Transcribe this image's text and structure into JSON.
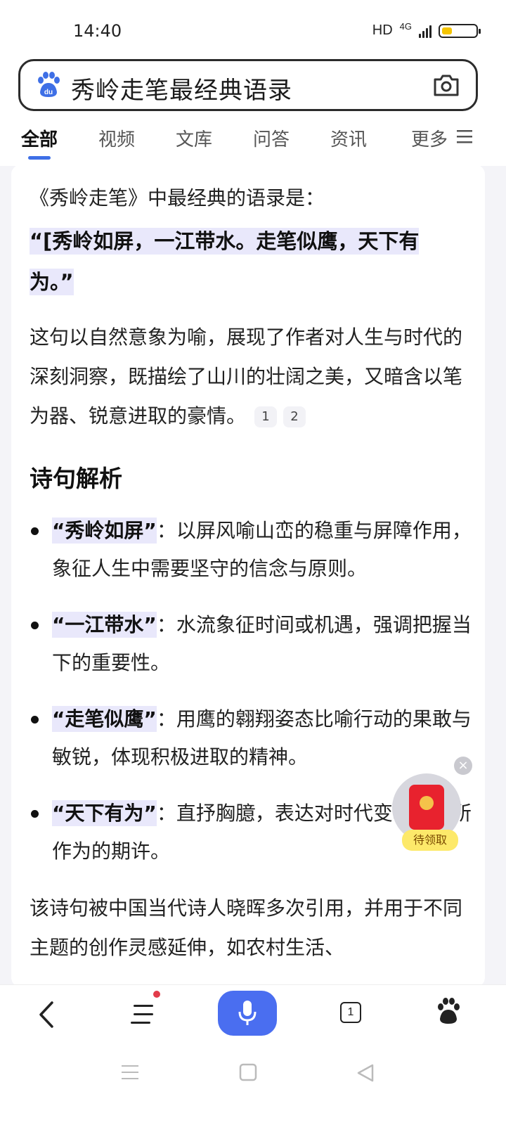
{
  "status_bar": {
    "time": "14:40",
    "hd": "HD",
    "network": "4G",
    "battery_level": 0.3
  },
  "search": {
    "query": "秀岭走笔最经典语录",
    "logo_text": "du"
  },
  "tabs": [
    {
      "label": "全部",
      "active": true
    },
    {
      "label": "视频",
      "active": false
    },
    {
      "label": "文库",
      "active": false
    },
    {
      "label": "问答",
      "active": false
    },
    {
      "label": "资讯",
      "active": false
    },
    {
      "label": "更多",
      "active": false
    }
  ],
  "answer": {
    "intro": "《秀岭走笔》中最经典的语录是：",
    "quote_line1": "“[秀岭如屏，一江带水。走笔似鹰，天下有",
    "quote_line2": "为。”",
    "para1": "这句以自然意象为喻，展现了作者对人生与时代的深刻洞察，既描绘了山川的壮阔之美，又暗含以笔为器、锐意进取的豪情。",
    "cite1": "1",
    "cite2": "2",
    "heading": "诗句解析",
    "bullets": [
      {
        "term": "“秀岭如屏”",
        "text": "：以屏风喻山峦的稳重与屏障作用，象征人生中需要坚守的信念与原则。"
      },
      {
        "term": "“一江带水”",
        "text": "：水流象征时间或机遇，强调把握当下的重要性。"
      },
      {
        "term": "“走笔似鹰”",
        "text": "：用鹰的翱翔姿态比喻行动的果敢与敏锐，体现积极进取的精神。"
      },
      {
        "term": "“天下有为”",
        "text": "：直抒胸臆，表达对时代变革中有所作为的期许。"
      }
    ],
    "para2": "该诗句被中国当代诗人晓晖多次引用，并用于不同主题的创作灵感延伸，如农村生活、"
  },
  "float": {
    "label": "待领取",
    "close": "×"
  },
  "bottom_nav": {
    "tab_count": "1"
  },
  "colors": {
    "accent": "#4a6ef0",
    "highlight": "#e9e8fb",
    "packet": "#e8222e"
  }
}
